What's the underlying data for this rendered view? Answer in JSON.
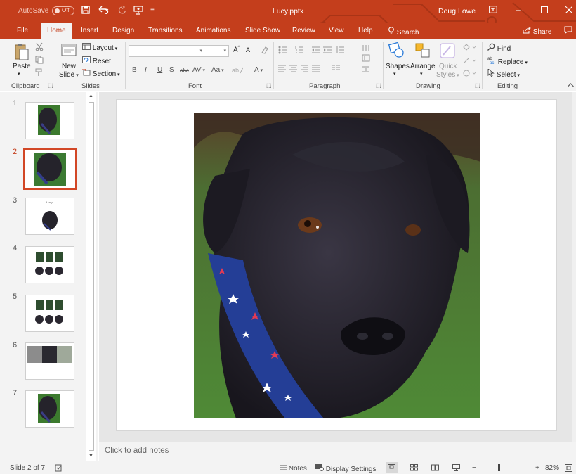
{
  "titlebar": {
    "autosave_label": "AutoSave",
    "autosave_state": "Off",
    "save_icon": "save-icon",
    "undo_icon": "undo-icon",
    "redo_icon": "redo-icon",
    "document_title": "Lucy.pptx",
    "user_name": "Doug Lowe",
    "accent_color": "#c43e1c"
  },
  "tabs": {
    "file": "File",
    "home": "Home",
    "insert": "Insert",
    "design": "Design",
    "transitions": "Transitions",
    "animations": "Animations",
    "slideshow": "Slide Show",
    "review": "Review",
    "view": "View",
    "help": "Help",
    "search": "Search",
    "share": "Share"
  },
  "ribbon": {
    "clipboard": {
      "label": "Clipboard",
      "paste": "Paste"
    },
    "slides": {
      "label": "Slides",
      "new_slide_line1": "New",
      "new_slide_line2": "Slide",
      "layout": "Layout",
      "reset": "Reset",
      "section": "Section"
    },
    "font": {
      "label": "Font",
      "bold": "B",
      "italic": "I",
      "underline": "U",
      "shadow": "S",
      "strike": "abc",
      "spacing": "AV",
      "case": "Aa",
      "grow": "A",
      "shrink": "A",
      "color": "A"
    },
    "paragraph": {
      "label": "Paragraph"
    },
    "drawing": {
      "label": "Drawing",
      "shapes": "Shapes",
      "arrange": "Arrange",
      "quick_line1": "Quick",
      "quick_line2": "Styles"
    },
    "editing": {
      "label": "Editing",
      "find": "Find",
      "replace": "Replace",
      "select": "Select"
    }
  },
  "slides": {
    "numbers": [
      "1",
      "2",
      "3",
      "4",
      "5",
      "6",
      "7"
    ],
    "selected": 2,
    "slide3_caption": "Lucy"
  },
  "notes": {
    "placeholder": "Click to add notes"
  },
  "status": {
    "slide_info": "Slide 2 of 7",
    "notes": "Notes",
    "display_settings": "Display Settings",
    "zoom_minus": "−",
    "zoom_plus": "+",
    "zoom": "82%",
    "zoom_fraction": 0.82
  }
}
